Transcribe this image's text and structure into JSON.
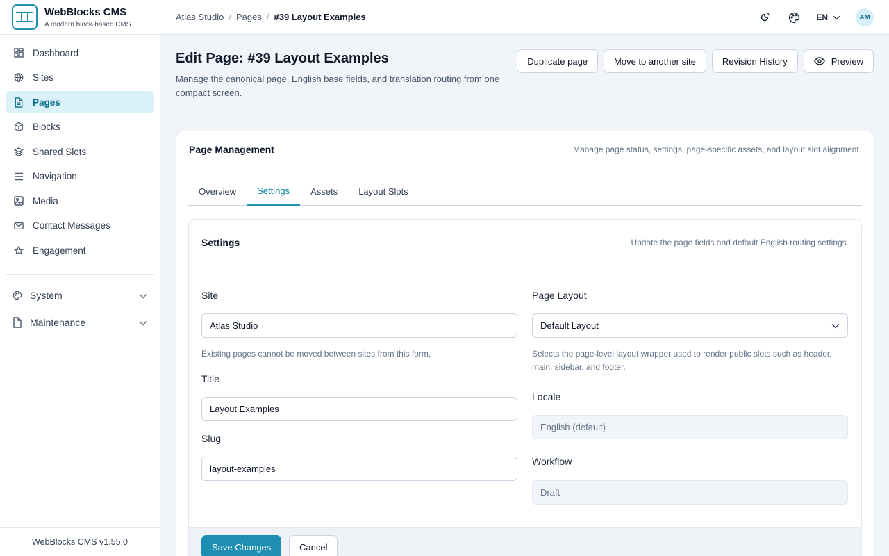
{
  "brand": {
    "title": "WebBlocks CMS",
    "subtitle": "A modern block-based CMS",
    "version": "WebBlocks CMS v1.55.0"
  },
  "sidebar": {
    "items": [
      {
        "label": "Dashboard",
        "icon": "dashboard-icon"
      },
      {
        "label": "Sites",
        "icon": "globe-icon"
      },
      {
        "label": "Pages",
        "icon": "document-icon",
        "active": true
      },
      {
        "label": "Blocks",
        "icon": "cube-icon"
      },
      {
        "label": "Shared Slots",
        "icon": "layers-icon"
      },
      {
        "label": "Navigation",
        "icon": "menu-icon"
      },
      {
        "label": "Media",
        "icon": "image-icon"
      },
      {
        "label": "Contact Messages",
        "icon": "mail-icon"
      },
      {
        "label": "Engagement",
        "icon": "star-icon"
      }
    ],
    "groups": [
      {
        "label": "System",
        "icon": "palette-icon"
      },
      {
        "label": "Maintenance",
        "icon": "file-icon"
      }
    ]
  },
  "topbar": {
    "breadcrumb": [
      "Atlas Studio",
      "Pages"
    ],
    "current": "#39 Layout Examples",
    "language": "EN",
    "avatar": "AM"
  },
  "page": {
    "title": "Edit Page: #39 Layout Examples",
    "description": "Manage the canonical page, English base fields, and translation routing from one compact screen.",
    "buttons": {
      "duplicate": "Duplicate page",
      "move": "Move to another site",
      "revisions": "Revision History",
      "preview": "Preview"
    }
  },
  "management": {
    "title": "Page Management",
    "note": "Manage page status, settings, page-specific assets, and layout slot alignment.",
    "tabs": [
      "Overview",
      "Settings",
      "Assets",
      "Layout Slots"
    ],
    "active_tab": "Settings"
  },
  "settings": {
    "title": "Settings",
    "note": "Update the page fields and default English routing settings.",
    "site": {
      "label": "Site",
      "value": "Atlas Studio",
      "help": "Existing pages cannot be moved between sites from this form."
    },
    "title_field": {
      "label": "Title",
      "value": "Layout Examples"
    },
    "slug": {
      "label": "Slug",
      "value": "layout-examples"
    },
    "layout": {
      "label": "Page Layout",
      "value": "Default Layout",
      "help": "Selects the page-level layout wrapper used to render public slots such as header, main, sidebar, and footer."
    },
    "locale": {
      "label": "Locale",
      "value": "English (default)"
    },
    "workflow": {
      "label": "Workflow",
      "value": "Draft"
    },
    "save": "Save Changes",
    "cancel": "Cancel"
  },
  "colors": {
    "accent": "#1e8fb3",
    "active_bg": "#daf1f8",
    "background": "#f1f5f9"
  }
}
